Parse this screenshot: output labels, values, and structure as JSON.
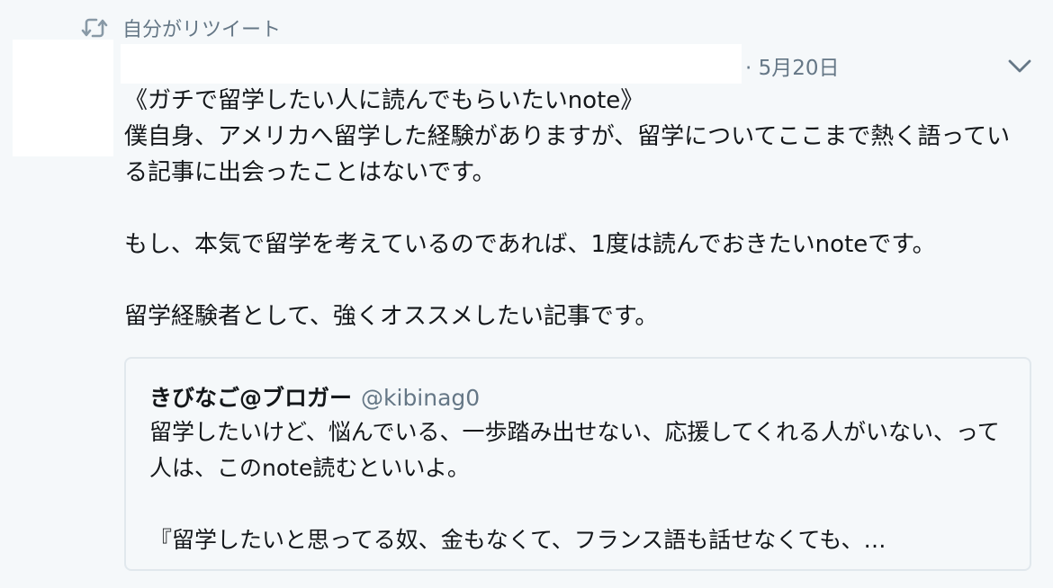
{
  "retweet": {
    "label": "自分がリツイート",
    "icon": "retweet-icon"
  },
  "tweet": {
    "timestamp": "· 5月20日",
    "text": "《ガチで留学したい人に読んでもらいたいnote》\n僕自身、アメリカへ留学した経験がありますが、留学についてここまで熱く語っている記事に出会ったことはないです。\n\nもし、本気で留学を考えているのであれば、1度は読んでおきたいnoteです。\n\n留学経験者として、強くオススメしたい記事です。",
    "caret_icon": "chevron-down-icon"
  },
  "quote": {
    "name": "きびなご@ブロガー",
    "handle": "@kibinag0",
    "text": "留学したいけど、悩んでいる、一歩踏み出せない、応援してくれる人がいない、って人は、このnote読むといいよ。\n\n『留学したいと思ってる奴、金もなくて、フランス語も話せなくても、…"
  },
  "colors": {
    "background": "#f5f8fa",
    "secondary_text": "#657786",
    "primary_text": "#14171a",
    "border": "#e1e8ed"
  }
}
